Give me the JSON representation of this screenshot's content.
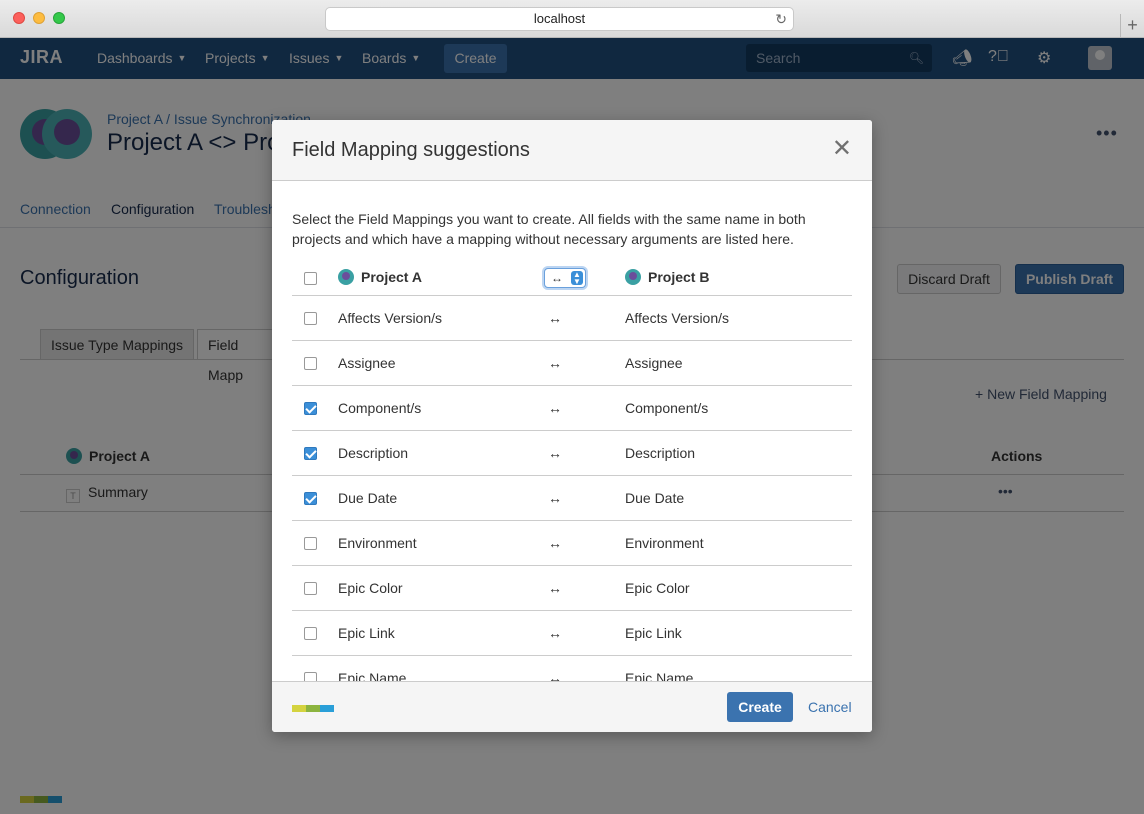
{
  "browser": {
    "url": "localhost"
  },
  "header": {
    "logo": "JIRA",
    "nav": [
      {
        "label": "Dashboards"
      },
      {
        "label": "Projects"
      },
      {
        "label": "Issues"
      },
      {
        "label": "Boards"
      }
    ],
    "create_label": "Create",
    "search_placeholder": "Search",
    "colors": {
      "bar": "#205081",
      "accent": "#3b73af"
    }
  },
  "page": {
    "breadcrumb": "Project A / Issue Synchronization",
    "title": "Project A <> Pro",
    "tabs": [
      {
        "label": "Connection"
      },
      {
        "label": "Configuration"
      },
      {
        "label": "Troublesh"
      }
    ],
    "section_title": "Configuration",
    "discard_label": "Discard Draft",
    "publish_label": "Publish Draft",
    "subtabs": [
      {
        "label": "Issue Type Mappings"
      },
      {
        "label": "Field Mapp"
      }
    ],
    "new_field_label": "New Field Mapping",
    "table": {
      "col_project": "Project A",
      "col_actions": "Actions",
      "rows": [
        {
          "field": "Summary"
        }
      ]
    }
  },
  "dialog": {
    "title": "Field Mapping suggestions",
    "description": "Select the Field Mappings you want to create. All fields with the same name in both projects and which have a mapping without necessary arguments are listed here.",
    "col_a": "Project A",
    "col_b": "Project B",
    "direction": "↔",
    "rows": [
      {
        "a": "Affects Version/s",
        "dir": "↔",
        "b": "Affects Version/s",
        "checked": false
      },
      {
        "a": "Assignee",
        "dir": "↔",
        "b": "Assignee",
        "checked": false
      },
      {
        "a": "Component/s",
        "dir": "↔",
        "b": "Component/s",
        "checked": true
      },
      {
        "a": "Description",
        "dir": "↔",
        "b": "Description",
        "checked": true
      },
      {
        "a": "Due Date",
        "dir": "↔",
        "b": "Due Date",
        "checked": true
      },
      {
        "a": "Environment",
        "dir": "↔",
        "b": "Environment",
        "checked": false
      },
      {
        "a": "Epic Color",
        "dir": "↔",
        "b": "Epic Color",
        "checked": false
      },
      {
        "a": "Epic Link",
        "dir": "↔",
        "b": "Epic Link",
        "checked": false
      },
      {
        "a": "Epic Name",
        "dir": "↔",
        "b": "Epic Name",
        "checked": false
      }
    ],
    "create_label": "Create",
    "cancel_label": "Cancel",
    "logo_colors": [
      "#d4d33f",
      "#8cb43f",
      "#2a9fd8"
    ]
  }
}
